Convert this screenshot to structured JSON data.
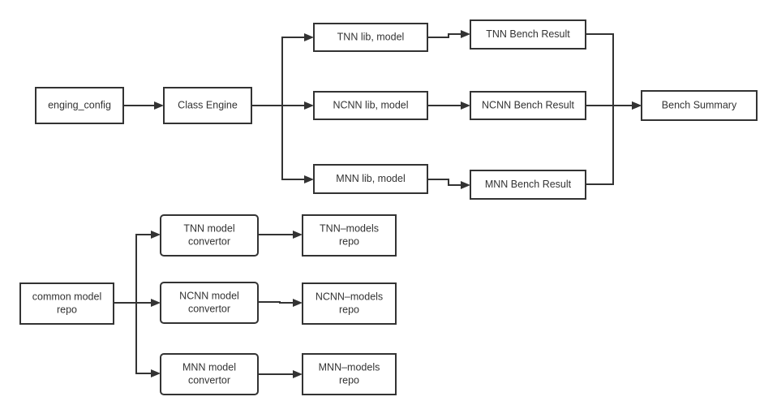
{
  "diagram": {
    "colors": {
      "stroke": "#333333",
      "fill": "#ffffff",
      "text": "#333333"
    },
    "nodes": {
      "engine_config": {
        "lines": [
          "enging_config"
        ]
      },
      "class_engine": {
        "lines": [
          "Class Engine"
        ]
      },
      "tnn_lib": {
        "lines": [
          "TNN lib, model"
        ]
      },
      "ncnn_lib": {
        "lines": [
          "NCNN lib, model"
        ]
      },
      "mnn_lib": {
        "lines": [
          "MNN lib, model"
        ]
      },
      "tnn_bench": {
        "lines": [
          "TNN Bench Result"
        ]
      },
      "ncnn_bench": {
        "lines": [
          "NCNN Bench Result"
        ]
      },
      "mnn_bench": {
        "lines": [
          "MNN Bench Result"
        ]
      },
      "bench_summary": {
        "lines": [
          "Bench Summary"
        ]
      },
      "common_repo": {
        "lines": [
          "common model",
          "repo"
        ]
      },
      "tnn_conv": {
        "lines": [
          "TNN model",
          "convertor"
        ]
      },
      "ncnn_conv": {
        "lines": [
          "NCNN model",
          "convertor"
        ]
      },
      "mnn_conv": {
        "lines": [
          "MNN model",
          "convertor"
        ]
      },
      "tnn_repo": {
        "lines": [
          "TNN–models",
          "repo"
        ]
      },
      "ncnn_repo": {
        "lines": [
          "NCNN–models",
          "repo"
        ]
      },
      "mnn_repo": {
        "lines": [
          "MNN–models",
          "repo"
        ]
      }
    },
    "edges": [
      [
        "engine_config",
        "class_engine"
      ],
      [
        "class_engine",
        "tnn_lib"
      ],
      [
        "class_engine",
        "ncnn_lib"
      ],
      [
        "class_engine",
        "mnn_lib"
      ],
      [
        "tnn_lib",
        "tnn_bench"
      ],
      [
        "ncnn_lib",
        "ncnn_bench"
      ],
      [
        "mnn_lib",
        "mnn_bench"
      ],
      [
        "tnn_bench",
        "bench_summary"
      ],
      [
        "ncnn_bench",
        "bench_summary"
      ],
      [
        "mnn_bench",
        "bench_summary"
      ],
      [
        "common_repo",
        "tnn_conv"
      ],
      [
        "common_repo",
        "ncnn_conv"
      ],
      [
        "common_repo",
        "mnn_conv"
      ],
      [
        "tnn_conv",
        "tnn_repo"
      ],
      [
        "ncnn_conv",
        "ncnn_repo"
      ],
      [
        "mnn_conv",
        "mnn_repo"
      ]
    ]
  }
}
